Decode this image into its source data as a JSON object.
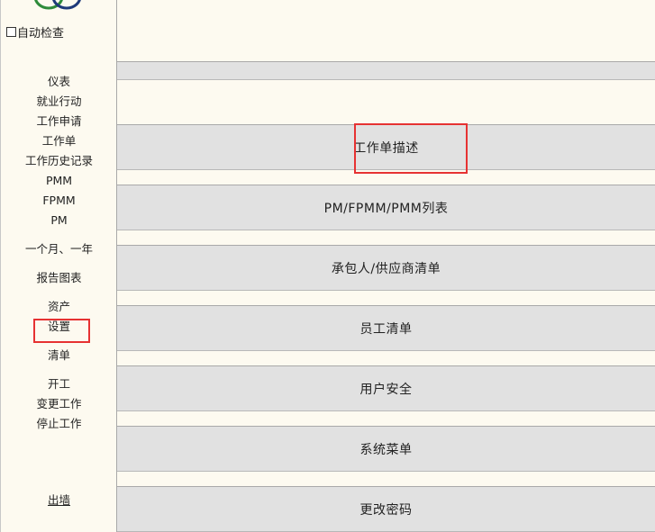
{
  "sidebar": {
    "auto_check_label": "自动检查",
    "nav": {
      "dashboard": "仪表",
      "employment_action": "就业行动",
      "work_request": "工作申请",
      "work_order": "工作单",
      "work_history": "工作历史记录",
      "pmm": "PMM",
      "fpmm": "FPMM",
      "pm": "PM",
      "month_year": "一个月、一年",
      "report_charts": "报告图表",
      "assets": "资产",
      "settings": "设置",
      "list": "清单",
      "start_work": "开工",
      "change_work": "变更工作",
      "stop_work": "停止工作",
      "logout": "出墙"
    }
  },
  "main": {
    "menu": [
      "工作单描述",
      "PM/FPMM/PMM列表",
      "承包人/供应商清单",
      "员工清单",
      "用户安全",
      "系统菜单",
      "更改密码"
    ]
  },
  "colors": {
    "background": "#fdfaf0",
    "band": "#e1e1e1",
    "highlight": "#e63232",
    "logo_blue": "#1f3a7a",
    "logo_green": "#2e8b3a"
  }
}
